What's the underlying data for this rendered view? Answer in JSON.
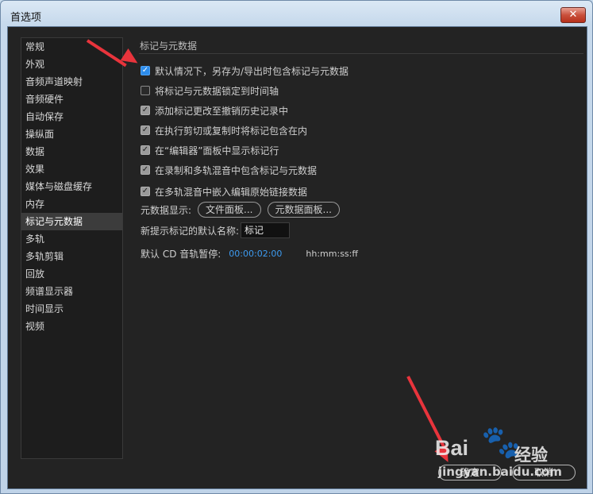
{
  "window": {
    "title": "首选项",
    "close_glyph": "✕"
  },
  "sidebar": {
    "items": [
      "常规",
      "外观",
      "音频声道映射",
      "音频硬件",
      "自动保存",
      "操纵面",
      "数据",
      "效果",
      "媒体与磁盘缓存",
      "内存",
      "标记与元数据",
      "多轨",
      "多轨剪辑",
      "回放",
      "频谱显示器",
      "时间显示",
      "视频"
    ],
    "active": "标记与元数据"
  },
  "section": {
    "title": "标记与元数据"
  },
  "options": [
    {
      "label": "默认情况下，另存为/导出时包含标记与元数据",
      "checked": true
    },
    {
      "label": "将标记与元数据锁定到时间轴",
      "checked": false
    },
    {
      "label": "添加标记更改至撤销历史记录中",
      "checked": true
    },
    {
      "label": "在执行剪切或复制时将标记包含在内",
      "checked": true
    },
    {
      "label": "在“编辑器”面板中显示标记行",
      "checked": true
    },
    {
      "label": "在录制和多轨混音中包含标记与元数据",
      "checked": true
    },
    {
      "label": "在多轨混音中嵌入编辑原始链接数据",
      "checked": true
    }
  ],
  "metadata_display": {
    "label": "元数据显示:",
    "file_panel_button": "文件面板...",
    "metadata_panel_button": "元数据面板..."
  },
  "default_marker_name": {
    "label": "新提示标记的默认名称:",
    "value": "标记"
  },
  "cd_pause": {
    "label": "默认 CD 音轨暂停:",
    "value": "00:00:02:00",
    "format": "hh:mm:ss:ff"
  },
  "footer": {
    "ok_label": "确定",
    "cancel_label": "取消"
  },
  "watermark": {
    "brand": "Bai",
    "brand_cn": "经验",
    "url": "jingyan.baidu.com"
  },
  "colors": {
    "accent": "#2d8ceb",
    "annotation": "#e8343c",
    "panel": "#232323"
  },
  "icons": {
    "check": "checkmark-icon",
    "close": "close-icon"
  }
}
